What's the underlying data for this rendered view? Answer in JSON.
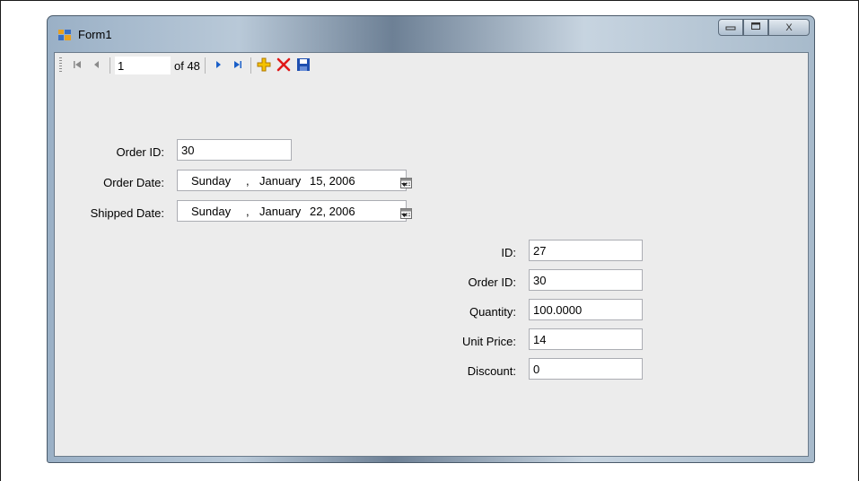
{
  "window": {
    "title": "Form1",
    "controls": {
      "minimize": "minimize",
      "maximize": "maximize",
      "close": "X"
    }
  },
  "navigator": {
    "position": "1",
    "count_label": "of 48",
    "icons": [
      "move-first-icon",
      "move-previous-icon",
      "move-next-icon",
      "move-last-icon",
      "add-new-icon",
      "delete-icon",
      "save-icon"
    ]
  },
  "order": {
    "order_id_label": "Order ID:",
    "order_id_value": "30",
    "order_date_label": "Order Date:",
    "order_date": {
      "weekday": "Sunday",
      "sep": ",",
      "month": "January",
      "day_year": "15, 2006"
    },
    "shipped_date_label": "Shipped Date:",
    "shipped_date": {
      "weekday": "Sunday",
      "sep": ",",
      "month": "January",
      "day_year": "22, 2006"
    }
  },
  "detail": {
    "id_label": "ID:",
    "id_value": "27",
    "order_id_label": "Order ID:",
    "order_id_value": "30",
    "quantity_label": "Quantity:",
    "quantity_value": "100.0000",
    "unit_price_label": "Unit Price:",
    "unit_price_value": "14",
    "discount_label": "Discount:",
    "discount_value": "0"
  }
}
